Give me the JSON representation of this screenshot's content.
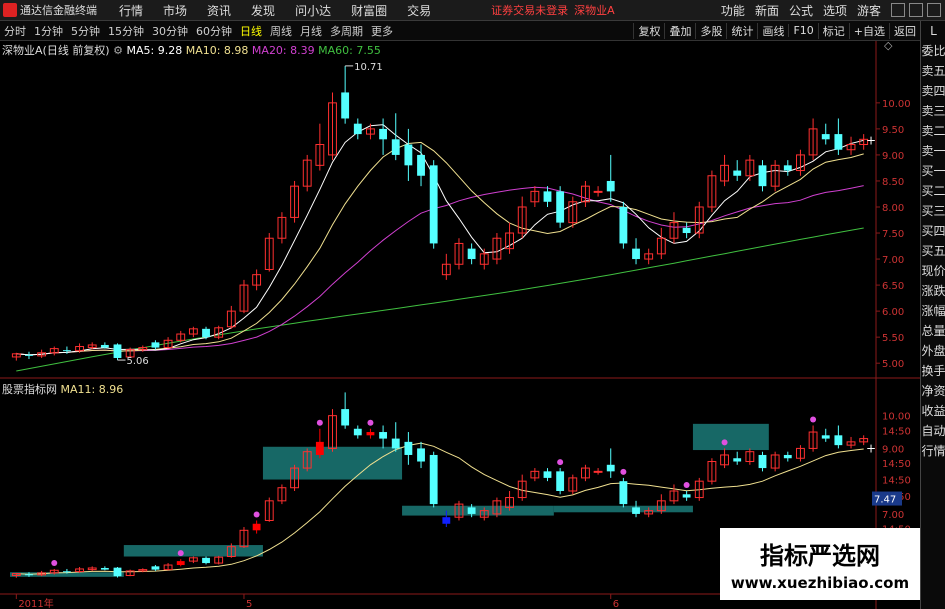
{
  "menubar": {
    "app_title": "通达信金融终端",
    "items": [
      "行情",
      "市场",
      "资讯",
      "发现",
      "问小达",
      "财富圈",
      "交易"
    ],
    "alert1": "证券交易未登录",
    "alert2": "深物业A",
    "right_items": [
      "功能",
      "新面",
      "公式",
      "选项",
      "游客"
    ]
  },
  "tabs": {
    "items": [
      "分时",
      "1分钟",
      "5分钟",
      "15分钟",
      "30分钟",
      "60分钟",
      "日线",
      "周线",
      "月线",
      "多周期",
      "更多"
    ],
    "active_index": 6,
    "right_items": [
      "复权",
      "叠加",
      "多股",
      "统计",
      "画线",
      "F10",
      "标记",
      "+自选",
      "返回"
    ]
  },
  "right_panel": {
    "items": [
      "L",
      "委比",
      "卖五",
      "卖四",
      "卖三",
      "卖二",
      "卖一",
      "买一",
      "买二",
      "买三",
      "买四",
      "买五",
      "现价",
      "涨跌",
      "涨幅",
      "总量",
      "外盘",
      "换手",
      "净资",
      "收益",
      "自动",
      "行情"
    ]
  },
  "main_chart": {
    "legend_name": "深物业A(日线 前复权)",
    "ma5": "MA5: 9.28",
    "ma10": "MA10: 8.98",
    "ma20": "MA20: 8.39",
    "ma60": "MA60: 7.55",
    "high_label": "10.71",
    "low_label": "5.06",
    "y_ticks": [
      "10.00",
      "9.50",
      "9.00",
      "8.50",
      "8.00",
      "7.50",
      "7.00",
      "6.50",
      "6.00",
      "5.50",
      "5.00"
    ]
  },
  "sub_chart": {
    "legend_name": "股票指标网",
    "ma11": "MA11: 8.96",
    "y_ticks": [
      "10.00",
      "14:50",
      "9.00",
      "14:50",
      "14:50",
      "14:50",
      "7.00",
      "14:50"
    ],
    "value_box": "7.47"
  },
  "x_axis": {
    "labels": [
      "2011年",
      "5",
      "6"
    ]
  },
  "watermark": {
    "title": "指标严选网",
    "url": "www.xuezhibiao.com"
  },
  "colors": {
    "up": "#ff3030",
    "down": "#54ffff",
    "ma5": "#ffffff",
    "ma10": "#f0e090",
    "ma20": "#d040d0",
    "ma60": "#40c040",
    "zone": "#1b7a78"
  },
  "candles": [
    [
      5.12,
      5.18,
      5.05,
      5.2
    ],
    [
      5.16,
      5.14,
      5.08,
      5.22
    ],
    [
      5.14,
      5.2,
      5.1,
      5.26
    ],
    [
      5.2,
      5.28,
      5.15,
      5.32
    ],
    [
      5.25,
      5.24,
      5.18,
      5.32
    ],
    [
      5.24,
      5.32,
      5.2,
      5.38
    ],
    [
      5.3,
      5.35,
      5.26,
      5.4
    ],
    [
      5.35,
      5.3,
      5.28,
      5.4
    ],
    [
      5.36,
      5.1,
      5.06,
      5.38
    ],
    [
      5.12,
      5.26,
      5.1,
      5.3
    ],
    [
      5.26,
      5.3,
      5.22,
      5.34
    ],
    [
      5.4,
      5.3,
      5.26,
      5.44
    ],
    [
      5.3,
      5.44,
      5.28,
      5.5
    ],
    [
      5.44,
      5.56,
      5.4,
      5.62
    ],
    [
      5.56,
      5.66,
      5.5,
      5.7
    ],
    [
      5.66,
      5.5,
      5.46,
      5.7
    ],
    [
      5.5,
      5.68,
      5.46,
      5.72
    ],
    [
      5.7,
      6.0,
      5.66,
      6.1
    ],
    [
      6.0,
      6.5,
      5.96,
      6.6
    ],
    [
      6.5,
      6.7,
      6.4,
      6.8
    ],
    [
      6.8,
      7.4,
      6.76,
      7.5
    ],
    [
      7.4,
      7.8,
      7.3,
      7.9
    ],
    [
      7.8,
      8.4,
      7.7,
      8.5
    ],
    [
      8.4,
      8.9,
      8.3,
      9.0
    ],
    [
      8.8,
      9.2,
      8.7,
      9.6
    ],
    [
      9.0,
      10.0,
      8.9,
      10.2
    ],
    [
      10.2,
      9.7,
      9.6,
      10.71
    ],
    [
      9.6,
      9.4,
      9.3,
      9.7
    ],
    [
      9.4,
      9.5,
      9.3,
      9.6
    ],
    [
      9.5,
      9.3,
      9.0,
      9.7
    ],
    [
      9.3,
      9.0,
      8.9,
      9.8
    ],
    [
      9.2,
      8.8,
      8.5,
      9.5
    ],
    [
      9.0,
      8.6,
      8.4,
      9.2
    ],
    [
      8.8,
      7.3,
      7.2,
      8.9
    ],
    [
      6.7,
      6.9,
      6.6,
      7.1
    ],
    [
      6.9,
      7.3,
      6.8,
      7.4
    ],
    [
      7.2,
      7.0,
      6.9,
      7.3
    ],
    [
      6.9,
      7.1,
      6.8,
      7.2
    ],
    [
      7.0,
      7.4,
      6.9,
      7.5
    ],
    [
      7.2,
      7.5,
      7.1,
      7.7
    ],
    [
      7.5,
      8.0,
      7.4,
      8.2
    ],
    [
      8.1,
      8.3,
      8.0,
      8.4
    ],
    [
      8.3,
      8.1,
      8.0,
      8.4
    ],
    [
      8.3,
      7.7,
      7.6,
      8.4
    ],
    [
      7.7,
      8.1,
      7.6,
      8.2
    ],
    [
      8.1,
      8.4,
      8.0,
      8.5
    ],
    [
      8.3,
      8.3,
      8.2,
      8.4
    ],
    [
      8.5,
      8.3,
      8.1,
      9.0
    ],
    [
      8.0,
      7.3,
      7.2,
      8.1
    ],
    [
      7.2,
      7.0,
      6.9,
      7.4
    ],
    [
      7.0,
      7.1,
      6.9,
      7.2
    ],
    [
      7.1,
      7.4,
      7.0,
      7.6
    ],
    [
      7.4,
      7.7,
      7.3,
      7.9
    ],
    [
      7.6,
      7.5,
      7.4,
      7.7
    ],
    [
      7.5,
      8.0,
      7.4,
      8.1
    ],
    [
      8.0,
      8.6,
      7.9,
      8.7
    ],
    [
      8.5,
      8.8,
      8.4,
      9.0
    ],
    [
      8.7,
      8.6,
      8.5,
      8.9
    ],
    [
      8.6,
      8.9,
      8.5,
      9.0
    ],
    [
      8.8,
      8.4,
      8.3,
      8.9
    ],
    [
      8.4,
      8.8,
      8.3,
      8.9
    ],
    [
      8.8,
      8.7,
      8.6,
      8.9
    ],
    [
      8.7,
      9.0,
      8.6,
      9.1
    ],
    [
      9.0,
      9.5,
      8.9,
      9.7
    ],
    [
      9.4,
      9.3,
      9.2,
      9.6
    ],
    [
      9.4,
      9.1,
      9.0,
      9.7
    ],
    [
      9.1,
      9.2,
      9.0,
      9.35
    ],
    [
      9.2,
      9.3,
      9.1,
      9.4
    ]
  ],
  "sub_zones": [
    {
      "from": 0,
      "to": 8,
      "low": 5.08,
      "high": 5.22
    },
    {
      "from": 9,
      "to": 19,
      "low": 5.7,
      "high": 6.05
    },
    {
      "from": 20,
      "to": 30,
      "low": 8.05,
      "high": 9.05
    },
    {
      "from": 31,
      "to": 42,
      "low": 6.95,
      "high": 7.25
    },
    {
      "from": 43,
      "to": 53,
      "low": 7.05,
      "high": 7.25
    },
    {
      "from": 54,
      "to": 59,
      "low": 8.95,
      "high": 9.75
    }
  ]
}
